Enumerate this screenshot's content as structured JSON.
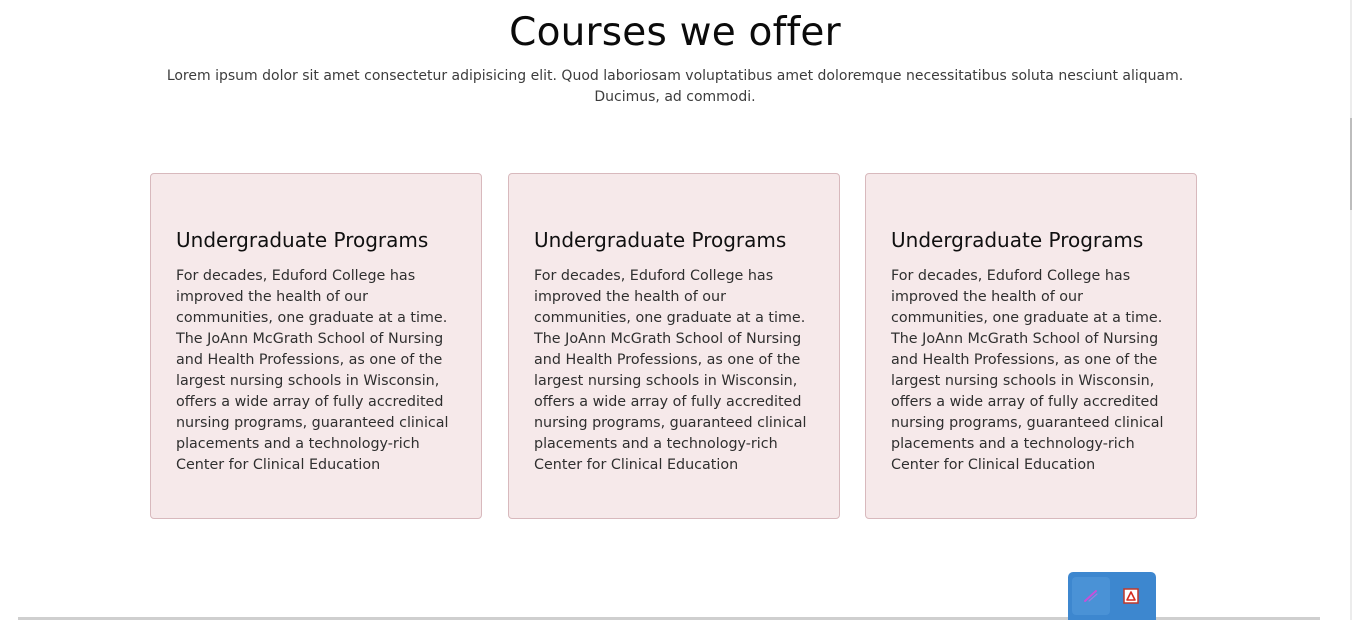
{
  "section": {
    "title": "Courses we offer",
    "subtitle": "Lorem ipsum dolor sit amet consectetur adipisicing elit. Quod laboriosam voluptatibus amet doloremque necessitatibus soluta nesciunt aliquam. Ducimus, ad commodi."
  },
  "cards": [
    {
      "title": "Undergraduate Programs",
      "text": "For decades, Eduford College has improved the health of our communities, one graduate at a time. The JoAnn McGrath School of Nursing and Health Professions, as one of the largest nursing schools in Wisconsin, offers a wide array of fully accredited nursing programs, guaranteed clinical placements and a technology-rich Center for Clinical Education"
    },
    {
      "title": "Undergraduate Programs",
      "text": "For decades, Eduford College has improved the health of our communities, one graduate at a time. The JoAnn McGrath School of Nursing and Health Professions, as one of the largest nursing schools in Wisconsin, offers a wide array of fully accredited nursing programs, guaranteed clinical placements and a technology-rich Center for Clinical Education"
    },
    {
      "title": "Undergraduate Programs",
      "text": "For decades, Eduford College has improved the health of our communities, one graduate at a time. The JoAnn McGrath School of Nursing and Health Professions, as one of the largest nursing schools in Wisconsin, offers a wide array of fully accredited nursing programs, guaranteed clinical placements and a technology-rich Center for Clinical Education"
    }
  ],
  "toolbar": {
    "buttons": [
      {
        "icon": "pen-icon"
      },
      {
        "icon": "pdf-icon"
      }
    ]
  },
  "colors": {
    "card_background": "#f6e9ea",
    "card_border": "#d8b9bd",
    "toolbar": "#3d87cf"
  }
}
